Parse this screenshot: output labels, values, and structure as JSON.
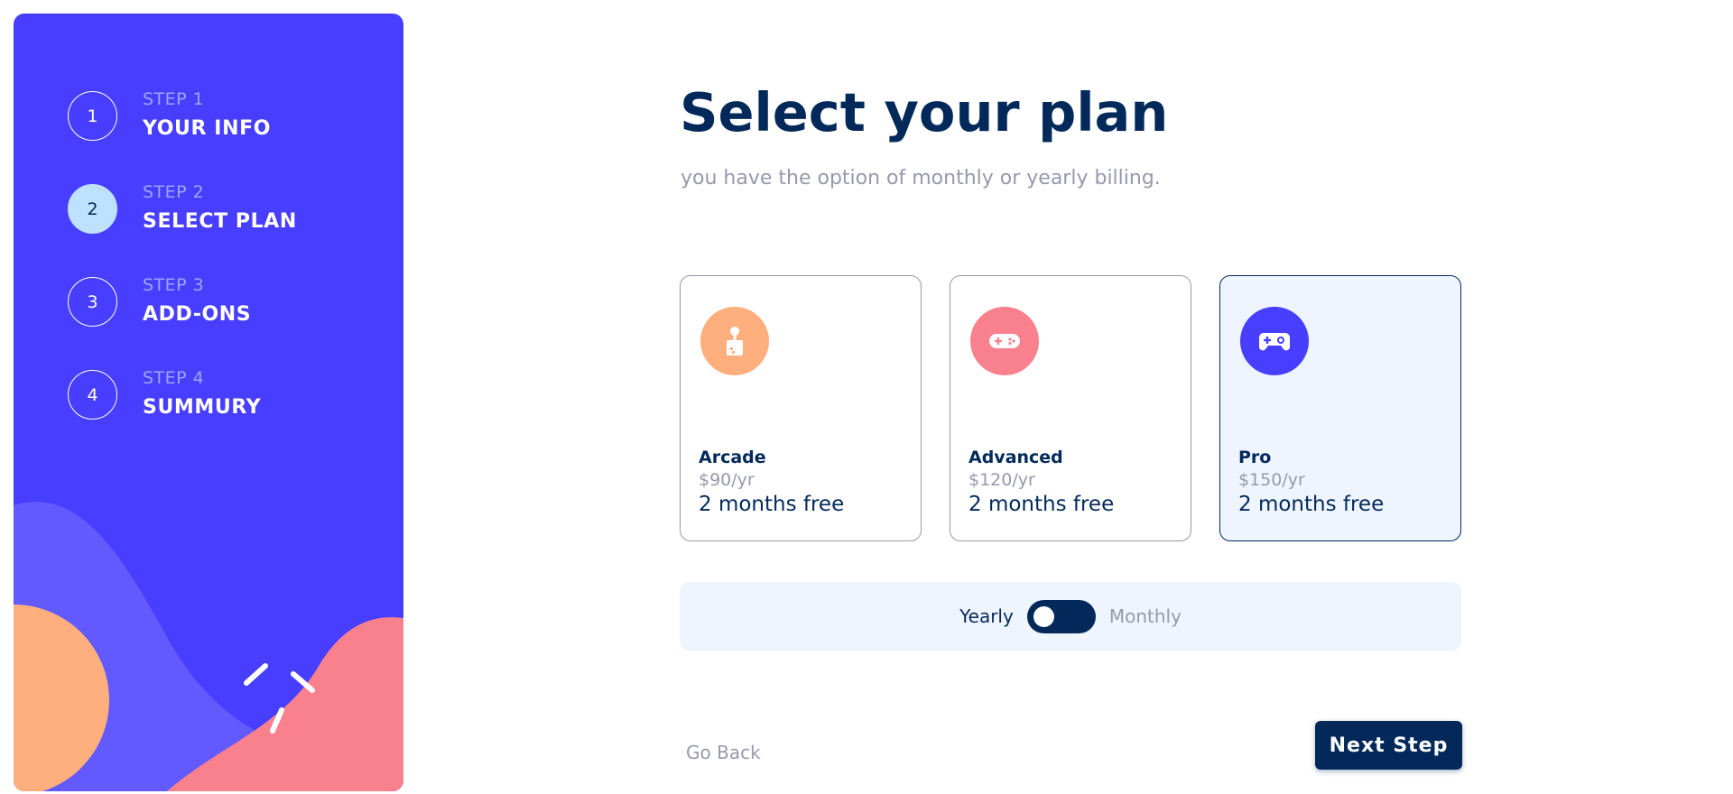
{
  "colors": {
    "sidebar_bg": "#483eff",
    "marine_blue": "#02295a",
    "light_blue": "#bee2fd",
    "cool_gray": "#9699ab",
    "magnolia": "#eff5ff",
    "orange": "#ffaf7e",
    "pink": "#f9818e",
    "purple": "#483eff"
  },
  "sidebar": {
    "steps": [
      {
        "number": "1",
        "small": "STEP 1",
        "label": "YOUR INFO",
        "active": false
      },
      {
        "number": "2",
        "small": "STEP 2",
        "label": "SELECT PLAN",
        "active": true
      },
      {
        "number": "3",
        "small": "STEP 3",
        "label": "ADD-ONS",
        "active": false
      },
      {
        "number": "4",
        "small": "STEP 4",
        "label": "SUMMURY",
        "active": false
      }
    ]
  },
  "main": {
    "title": "Select your plan",
    "subtitle": "you have the option of monthly or yearly billing.",
    "plans": [
      {
        "name": "Arcade",
        "price": "$90/yr",
        "promo": "2 months free",
        "icon": "arcade-joystick-icon",
        "icon_color": "#ffaf7e",
        "selected": false
      },
      {
        "name": "Advanced",
        "price": "$120/yr",
        "promo": "2 months free",
        "icon": "advanced-gamepad-icon",
        "icon_color": "#f9818e",
        "selected": false
      },
      {
        "name": "Pro",
        "price": "$150/yr",
        "promo": "2 months free",
        "icon": "pro-gamepad-icon",
        "icon_color": "#483eff",
        "selected": true
      }
    ],
    "billing": {
      "yearly_label": "Yearly",
      "monthly_label": "Monthly",
      "selected": "Yearly"
    },
    "footer": {
      "back_label": "Go Back",
      "next_label": "Next Step"
    }
  }
}
